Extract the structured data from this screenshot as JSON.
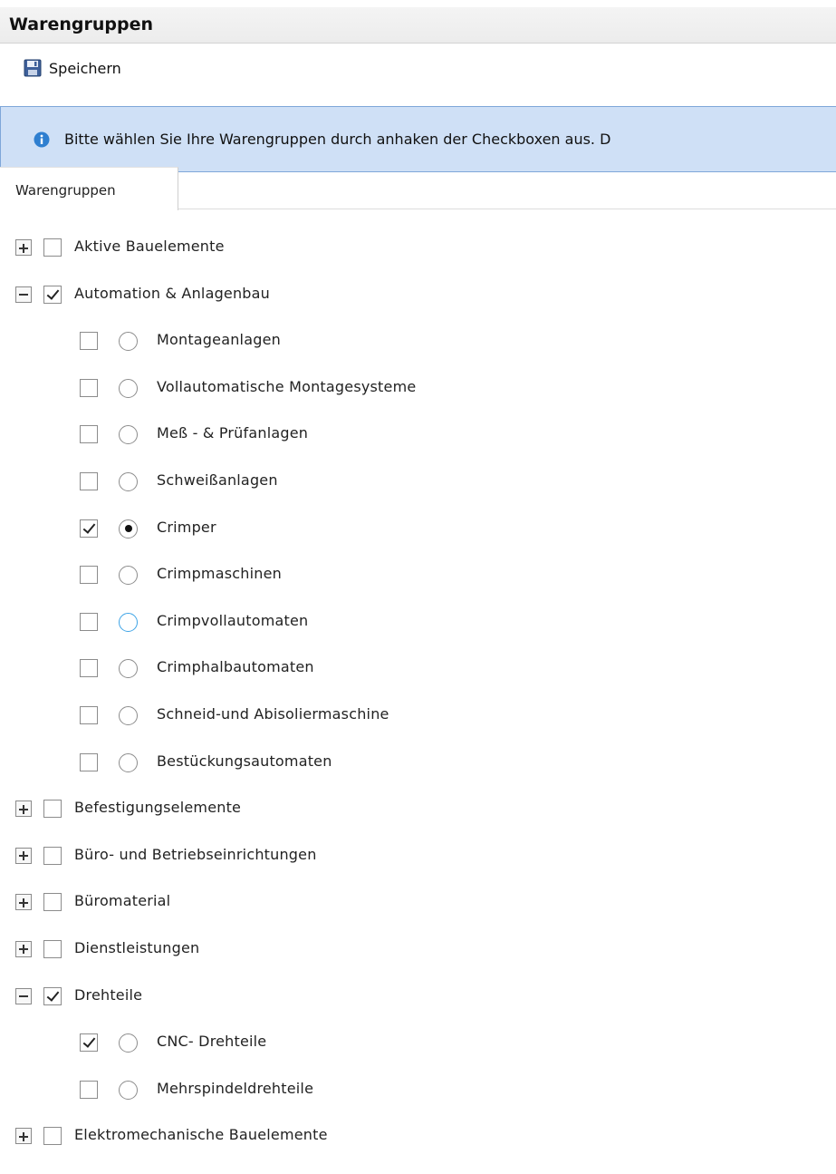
{
  "header": {
    "title": "Warengruppen"
  },
  "toolbar": {
    "save_label": "Speichern"
  },
  "info": {
    "text": "Bitte wählen Sie Ihre Warengruppen durch anhaken der Checkboxen aus. D"
  },
  "tabs": [
    {
      "label": "Warengruppen",
      "active": true
    }
  ],
  "tree": {
    "g0": {
      "label": "Aktive Bauelemente",
      "expanded": false,
      "checked": false
    },
    "g1": {
      "label": "Automation & Anlagenbau",
      "expanded": true,
      "checked": true,
      "children": [
        {
          "label": "Montageanlagen",
          "checked": false,
          "radio": false
        },
        {
          "label": "Vollautomatische Montagesysteme",
          "checked": false,
          "radio": false
        },
        {
          "label": "Meß - & Prüfanlagen",
          "checked": false,
          "radio": false
        },
        {
          "label": "Schweißanlagen",
          "checked": false,
          "radio": false
        },
        {
          "label": "Crimper",
          "checked": true,
          "radio": true
        },
        {
          "label": "Crimpmaschinen",
          "checked": false,
          "radio": false
        },
        {
          "label": "Crimpvollautomaten",
          "checked": false,
          "radio": false
        },
        {
          "label": "Crimphalbautomaten",
          "checked": false,
          "radio": false
        },
        {
          "label": "Schneid-und Abisoliermaschine",
          "checked": false,
          "radio": false
        },
        {
          "label": "Bestückungsautomaten",
          "checked": false,
          "radio": false
        }
      ]
    },
    "g2": {
      "label": "Befestigungselemente",
      "expanded": false,
      "checked": false
    },
    "g3": {
      "label": "Büro- und Betriebseinrichtungen",
      "expanded": false,
      "checked": false
    },
    "g4": {
      "label": "Büromaterial",
      "expanded": false,
      "checked": false
    },
    "g5": {
      "label": "Dienstleistungen",
      "expanded": false,
      "checked": false
    },
    "g6": {
      "label": "Drehteile",
      "expanded": true,
      "checked": true,
      "children": [
        {
          "label": "CNC- Drehteile",
          "checked": true,
          "radio": false
        },
        {
          "label": "Mehrspindeldrehteile",
          "checked": false,
          "radio": false
        }
      ]
    },
    "g7": {
      "label": "Elektromechanische Bauelemente",
      "expanded": false,
      "checked": false
    }
  },
  "colors": {
    "info_bg": "#cfe0f6",
    "info_border": "#7fa7d9",
    "info_icon": "#2f7fd0",
    "radio_hover": "#3ea4e6"
  }
}
